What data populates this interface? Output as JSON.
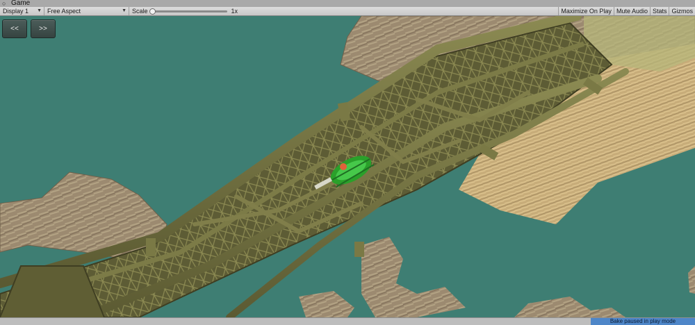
{
  "window": {
    "title": "Game",
    "icon": "game-controller-icon"
  },
  "toolbar": {
    "display_label": "Display 1",
    "aspect_label": "Free Aspect",
    "scale_label": "Scale",
    "scale_value": "1x",
    "scale_level": 0.0,
    "maximize_label": "Maximize On Play",
    "mute_label": "Mute Audio",
    "stats_label": "Stats",
    "gizmos_label": "Gizmos"
  },
  "scene": {
    "prev_button": "<<",
    "next_button": ">>",
    "colors": {
      "water": "#3e7e73",
      "structure": "#6e6e3c",
      "rock": "#9c8a70",
      "vehicle": "#2aa02a"
    }
  },
  "status": {
    "bake_message": "Bake paused in play mode"
  }
}
